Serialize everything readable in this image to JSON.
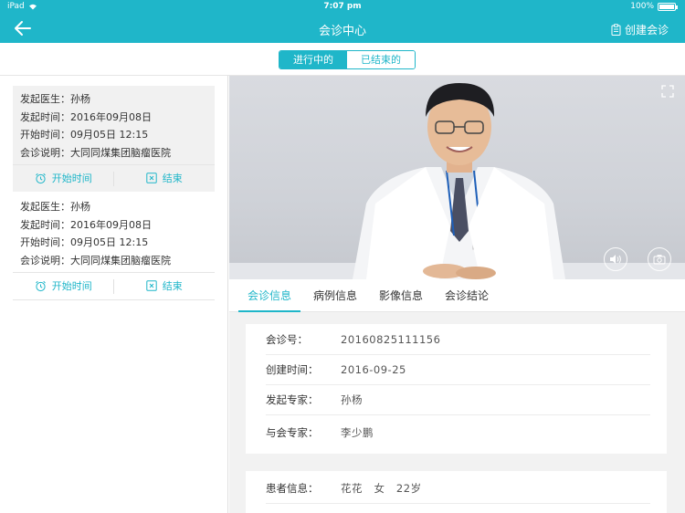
{
  "status_bar": {
    "device": "iPad",
    "time": "7:07 pm",
    "battery": "100%"
  },
  "header": {
    "title": "会诊中心",
    "create_label": "创建会诊"
  },
  "segments": {
    "active": "进行中的",
    "inactive": "已结束的"
  },
  "consultations": [
    {
      "doctor_label": "发起医生：",
      "doctor": "孙杨",
      "start_label": "发起时间：",
      "start": "2016年09月08日",
      "begin_label": "开始时间：",
      "begin": "09月05日 12:15",
      "note_label": "会诊说明：",
      "note": "大同同煤集团脑瘤医院",
      "action_start": "开始时间",
      "action_end": "结束"
    },
    {
      "doctor_label": "发起医生：",
      "doctor": "孙杨",
      "start_label": "发起时间：",
      "start": "2016年09月08日",
      "begin_label": "开始时间：",
      "begin": "09月05日 12:15",
      "note_label": "会诊说明：",
      "note": "大同同煤集团脑瘤医院",
      "action_start": "开始时间",
      "action_end": "结束"
    }
  ],
  "tabs": [
    "会诊信息",
    "病例信息",
    "影像信息",
    "会诊结论"
  ],
  "details": {
    "id_label": "会诊号：",
    "id": "20160825111156",
    "created_label": "创建时间：",
    "created": "2016-09-25",
    "initiator_label": "发起专家：",
    "initiator": "孙杨",
    "participants_label": "与会专家：",
    "participants": "李少鹏"
  },
  "patient": {
    "label": "患者信息：",
    "value": "花花   女   22岁"
  },
  "colors": {
    "accent": "#1fb6c9"
  }
}
